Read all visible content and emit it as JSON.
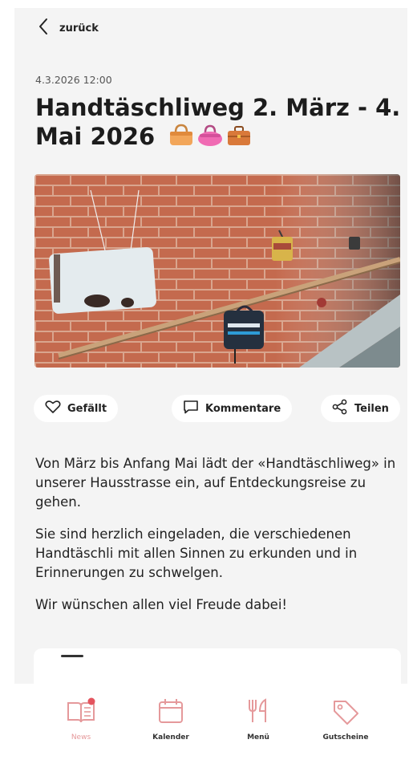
{
  "nav": {
    "back_label": "zurück"
  },
  "post": {
    "timestamp": "4.3.2026 12:00",
    "title": "Handtäschliweg 2. März - 4. Mai 2026",
    "title_emoji_icons": [
      "handbag-icon",
      "purse-icon",
      "briefcase-icon"
    ],
    "image_alt": "Handbags hanging on a brick wall along a handrail"
  },
  "actions": {
    "like_label": "Gefällt",
    "comments_label": "Kommentare",
    "share_label": "Teilen"
  },
  "body": {
    "paragraphs": [
      "Von März bis Anfang Mai lädt der «Handtäschliweg» in unserer Hausstrasse ein, auf Entdeckungsreise zu gehen.",
      "Sie sind herzlich eingeladen, die verschiedenen Handtäschli mit allen Sinnen zu erkunden und in Erinnerungen zu schwelgen.",
      "Wir wünschen allen viel Freude dabei!"
    ]
  },
  "tabbar": {
    "items": [
      {
        "label": "News",
        "icon": "news-book-icon",
        "active": true
      },
      {
        "label": "Kalender",
        "icon": "calendar-icon",
        "active": false
      },
      {
        "label": "Menü",
        "icon": "fork-knife-icon",
        "active": false
      },
      {
        "label": "Gutscheine",
        "icon": "tag-icon",
        "active": false
      }
    ]
  },
  "colors": {
    "accent": "#e5999b",
    "badge": "#e4545e",
    "background": "#f4f4f4",
    "text": "#1c1c1c"
  }
}
